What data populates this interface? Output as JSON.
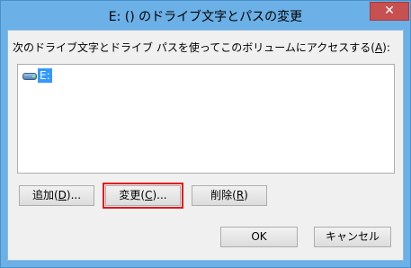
{
  "window": {
    "title": "E: () のドライブ文字とパスの変更",
    "close_glyph": "✕"
  },
  "dialog": {
    "instruction_prefix": "次のドライブ文字とドライブ パスを使ってこのボリュームにアクセスする(",
    "instruction_access_key": "A",
    "instruction_suffix": "):",
    "list_items": [
      {
        "label": "E:",
        "icon": "drive-icon",
        "selected": true
      }
    ]
  },
  "buttons": {
    "add": {
      "prefix": "追加(",
      "key": "D",
      "suffix": ")..."
    },
    "change": {
      "prefix": "変更(",
      "key": "C",
      "suffix": ")..."
    },
    "delete": {
      "prefix": "削除(",
      "key": "R",
      "suffix": ")"
    },
    "ok": "OK",
    "cancel": "キャンセル"
  },
  "colors": {
    "titlebar": "#6bb0e6",
    "close": "#c75050",
    "selection": "#3399ff",
    "highlight": "#e8141a"
  }
}
